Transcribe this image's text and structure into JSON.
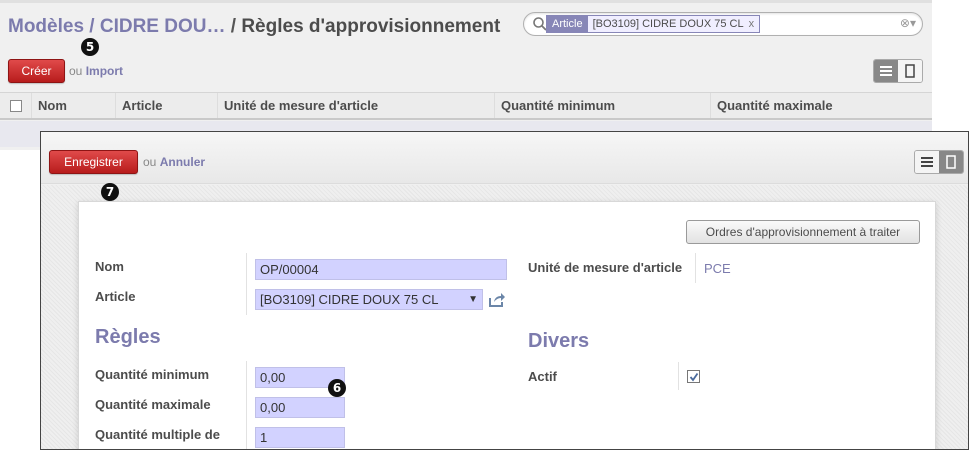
{
  "background": {
    "breadcrumb": {
      "parent": "Modèles / CIDRE DOU…",
      "separator": "/",
      "current": "Règles d'approvisionnement"
    },
    "search": {
      "facet_category": "Article",
      "facet_value": "[BO3109] CIDRE DOUX 75 CL",
      "facet_remove": "x",
      "controls": "⊗▾"
    },
    "create_button": "Créer",
    "or_text": "ou",
    "import_link": "Import",
    "columns": [
      "Nom",
      "Article",
      "Unité de mesure d'article",
      "Quantité minimum",
      "Quantité maximale"
    ],
    "markers": {
      "m5": "5"
    }
  },
  "popup": {
    "save_button": "Enregistrer",
    "or_text": "ou",
    "cancel_link": "Annuler",
    "procurement_button": "Ordres d'approvisionnement à traiter",
    "fields": {
      "name_label": "Nom",
      "name_value": "OP/00004",
      "article_label": "Article",
      "article_value": "[BO3109] CIDRE DOUX 75 CL",
      "uom_label": "Unité de mesure d'article",
      "uom_value": "PCE"
    },
    "rules": {
      "title": "Règles",
      "min_label": "Quantité minimum",
      "min_value": "0,00",
      "max_label": "Quantité maximale",
      "max_value": "0,00",
      "multiple_label": "Quantité multiple de",
      "multiple_value": "1"
    },
    "misc": {
      "title": "Divers",
      "active_label": "Actif",
      "active_checked": true
    },
    "markers": {
      "m6": "6",
      "m7": "7"
    }
  },
  "colors": {
    "accent": "#7c7bad",
    "primary_red": "#c92a2a",
    "field_bg": "#d2d2ff"
  }
}
